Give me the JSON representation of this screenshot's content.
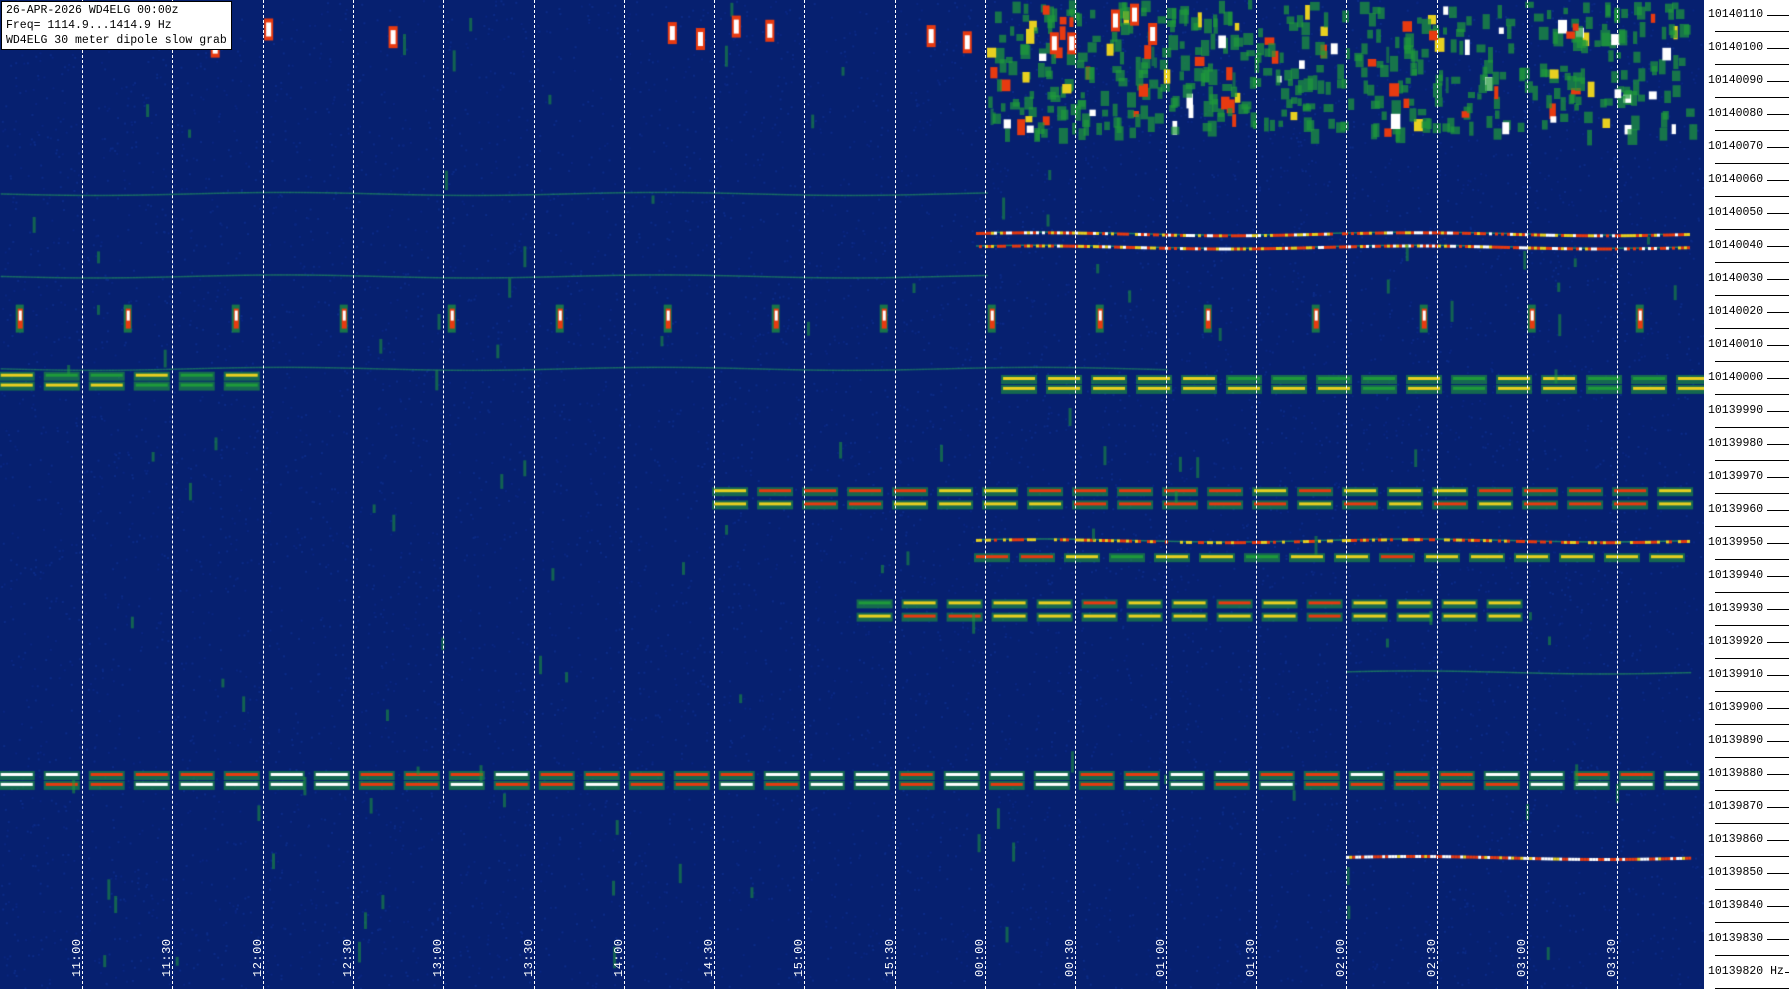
{
  "header": {
    "line1": "26-APR-2026  WD4ELG  00:00z",
    "line2": "Freq= 1114.9...1414.9 Hz",
    "line3": "WD4ELG 30 meter dipole slow grab"
  },
  "time_labels": [
    "11:00",
    "11:30",
    "12:00",
    "12:30",
    "13:00",
    "13:30",
    "14:00",
    "14:30",
    "15:00",
    "15:30",
    "00:00",
    "00:30",
    "01:00",
    "01:30",
    "02:00",
    "02:30",
    "03:00",
    "03:30"
  ],
  "freq_labels": [
    "10140110",
    "10140100",
    "10140090",
    "10140080",
    "10140070",
    "10140060",
    "10140050",
    "10140040",
    "10140030",
    "10140020",
    "10140010",
    "10140000",
    "10139990",
    "10139980",
    "10139970",
    "10139960",
    "10139950",
    "10139940",
    "10139930",
    "10139920",
    "10139910",
    "10139900",
    "10139890",
    "10139880",
    "10139870",
    "10139860",
    "10139850",
    "10139840",
    "10139830",
    "10139820 Hz"
  ],
  "colors": {
    "background": "#062070",
    "weak": "#1f9a3a",
    "mid": "#e8d020",
    "strong": "#e83a10",
    "peak": "#ffffff"
  },
  "signals": [
    {
      "kind": "line",
      "freq": 10140056,
      "start": -0.9,
      "end": 10.0,
      "level": 0.35
    },
    {
      "kind": "line",
      "freq": 10140031,
      "start": -0.9,
      "end": 10.0,
      "level": 0.35
    },
    {
      "kind": "line",
      "freq": 10140003,
      "start": -0.9,
      "end": 12.0,
      "level": 0.3
    },
    {
      "kind": "line",
      "freq": 10140044,
      "start": 9.9,
      "end": 17.8,
      "level": 0.9
    },
    {
      "kind": "line",
      "freq": 10140040,
      "start": 9.9,
      "end": 17.8,
      "level": 0.9
    },
    {
      "kind": "line",
      "freq": 10139951,
      "start": 9.9,
      "end": 17.8,
      "level": 0.75
    },
    {
      "kind": "line",
      "freq": 10139911,
      "start": 14.0,
      "end": 17.8,
      "level": 0.4
    },
    {
      "kind": "line",
      "freq": 10139855,
      "start": 14.0,
      "end": 17.8,
      "level": 1.0
    },
    {
      "kind": "dash",
      "freq": 10139880,
      "start": -0.9,
      "end": 17.8,
      "level": 1.0
    },
    {
      "kind": "dash",
      "freq": 10139877,
      "start": -0.9,
      "end": 17.8,
      "level": 1.0
    },
    {
      "kind": "dash",
      "freq": 10140001,
      "start": -0.9,
      "end": 1.8,
      "level": 0.55
    },
    {
      "kind": "dash",
      "freq": 10139998,
      "start": -0.9,
      "end": 1.8,
      "level": 0.55
    },
    {
      "kind": "dash",
      "freq": 10140000,
      "start": 10.2,
      "end": 17.8,
      "level": 0.6
    },
    {
      "kind": "dash",
      "freq": 10139997,
      "start": 10.2,
      "end": 17.8,
      "level": 0.6
    },
    {
      "kind": "dash",
      "freq": 10139966,
      "start": 7.0,
      "end": 17.8,
      "level": 0.8
    },
    {
      "kind": "dash",
      "freq": 10139962,
      "start": 7.0,
      "end": 17.8,
      "level": 0.8
    },
    {
      "kind": "dash",
      "freq": 10139946,
      "start": 9.9,
      "end": 17.8,
      "level": 0.7
    },
    {
      "kind": "dash",
      "freq": 10139932,
      "start": 8.6,
      "end": 15.9,
      "level": 0.7
    },
    {
      "kind": "dash",
      "freq": 10139928,
      "start": 8.6,
      "end": 15.9,
      "level": 0.7
    },
    {
      "kind": "dots",
      "freq": 10140018,
      "start": -0.9,
      "end": 17.8,
      "level": 1.0
    },
    {
      "kind": "noise",
      "freq": 10140095,
      "start": 10.0,
      "end": 17.8,
      "level": 0.7
    }
  ]
}
